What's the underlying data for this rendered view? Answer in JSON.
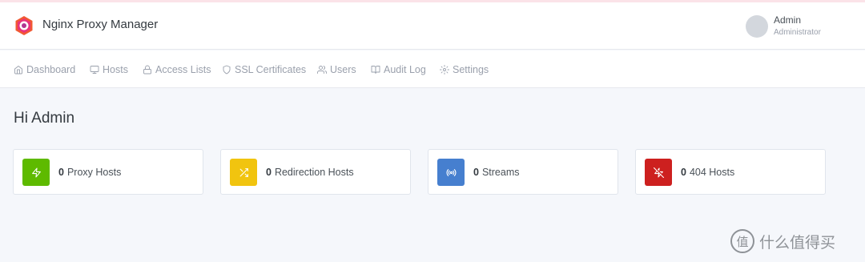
{
  "header": {
    "title": "Nginx Proxy Manager",
    "user": {
      "name": "Admin",
      "role": "Administrator"
    }
  },
  "nav": {
    "items": [
      {
        "label": "Dashboard",
        "icon": "home-icon"
      },
      {
        "label": "Hosts",
        "icon": "monitor-icon"
      },
      {
        "label": "Access Lists",
        "icon": "lock-icon"
      },
      {
        "label": "SSL Certificates",
        "icon": "shield-icon"
      },
      {
        "label": "Users",
        "icon": "users-icon"
      },
      {
        "label": "Audit Log",
        "icon": "book-open-icon"
      },
      {
        "label": "Settings",
        "icon": "gear-icon"
      }
    ]
  },
  "main": {
    "greeting": "Hi Admin",
    "cards": [
      {
        "count": "0",
        "label": "Proxy Hosts",
        "icon": "zap-icon",
        "color": "#5eba00"
      },
      {
        "count": "0",
        "label": "Redirection Hosts",
        "icon": "shuffle-icon",
        "color": "#f1c40f"
      },
      {
        "count": "0",
        "label": "Streams",
        "icon": "radio-icon",
        "color": "#467fcf"
      },
      {
        "count": "0",
        "label": "404 Hosts",
        "icon": "zap-off-icon",
        "color": "#cd201f"
      }
    ]
  },
  "watermark": {
    "glyph": "值",
    "text": "什么值得买"
  }
}
